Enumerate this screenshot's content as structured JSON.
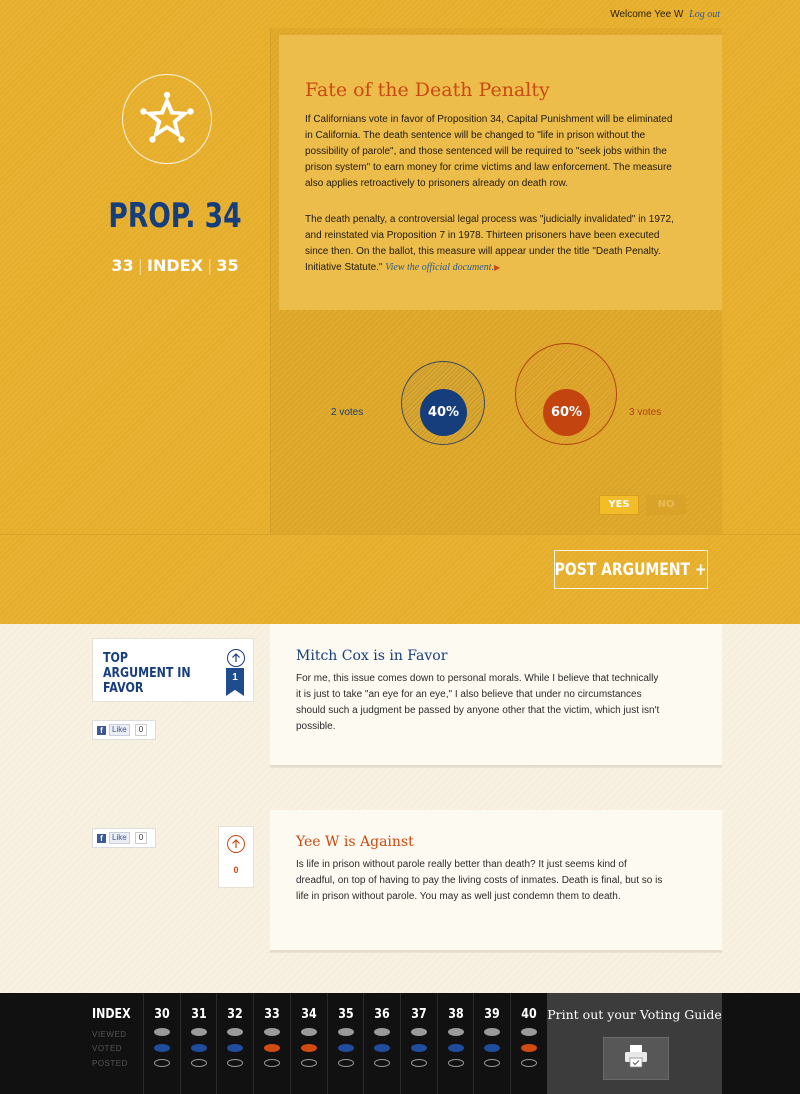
{
  "header": {
    "welcome": "Welcome Yee W",
    "logout": "Log out"
  },
  "prop": {
    "title": "PROP. 34",
    "prev": "33",
    "index": "INDEX",
    "next": "35"
  },
  "description": {
    "title": "Fate of the Death Penalty",
    "para1": "If Californians vote in favor of Proposition 34, Capital Punishment will be eliminated in California. The death sentence will be changed to \"life in prison without the possibility of parole\", and those sentenced will be required to \"seek jobs within the prison system\" to earn money for crime victims and law enforcement. The measure also applies retroactively to prisoners already on death row.",
    "para2": "The death penalty, a controversial legal process was \"judicially invalidated\" in 1972, and reinstated via Proposition 7 in 1978. Thirteen prisoners have been executed since then. On the ballot, this measure will appear under the title \"Death Penalty. Initiative Statute.\"",
    "official_link": "View the official document."
  },
  "poll": {
    "yes_votes": "2 votes",
    "yes_percent": "40%",
    "no_votes": "3 votes",
    "no_percent": "60%",
    "yes_label": "YES",
    "no_label": "NO",
    "yes_color": "#173e7c",
    "no_color": "#c4440f"
  },
  "post_argument": "POST ARGUMENT +",
  "arguments": [
    {
      "card_title": "TOP ARGUMENT IN FAVOR",
      "rank": "1",
      "like_label": "Like",
      "like_count": "0",
      "heading": "Mitch Cox is in Favor",
      "body": "For me, this issue comes down to personal morals. While I believe that technically it is just to take \"an eye for an eye,\" I also believe that under no circumstances should such a judgment be passed by anyone other that the victim, which just isn't possible."
    },
    {
      "like_label": "Like",
      "like_count": "0",
      "vote_count": "0",
      "heading": "Yee W is Against",
      "body": "Is life in prison without parole really better than death? It just seems kind of dreadful, on top of having to pay the living costs of inmates. Death is final, but so is life in prison without parole. You may as well just condemn them to death."
    }
  ],
  "index_bar": {
    "label": "INDEX",
    "rows": [
      "VIEWED",
      "VOTED",
      "POSTED"
    ],
    "props": [
      {
        "num": "30",
        "voted": "blue"
      },
      {
        "num": "31",
        "voted": "blue"
      },
      {
        "num": "32",
        "voted": "blue"
      },
      {
        "num": "33",
        "voted": "orange"
      },
      {
        "num": "34",
        "voted": "orange"
      },
      {
        "num": "35",
        "voted": "blue"
      },
      {
        "num": "36",
        "voted": "blue"
      },
      {
        "num": "37",
        "voted": "blue"
      },
      {
        "num": "38",
        "voted": "blue"
      },
      {
        "num": "39",
        "voted": "blue"
      },
      {
        "num": "40",
        "voted": "orange"
      }
    ],
    "print_label": "Print out your Voting Guide"
  }
}
